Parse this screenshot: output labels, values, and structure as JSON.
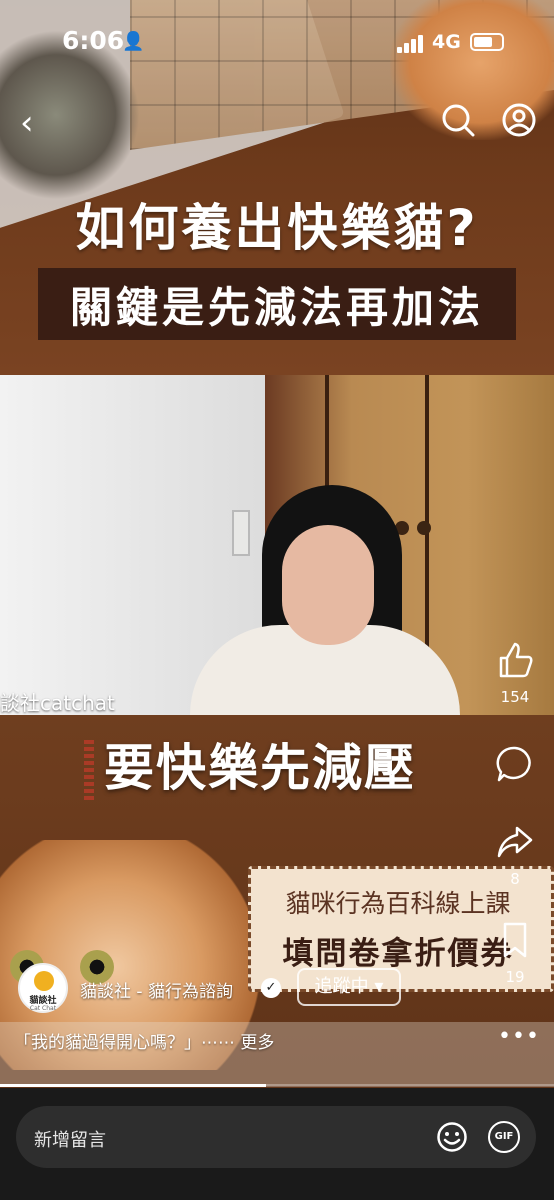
{
  "status_bar": {
    "time": "6:06",
    "network": "4G",
    "person_glyph": "👤"
  },
  "nav": {
    "back_glyph": "‹"
  },
  "video": {
    "title_line1": "如何養出快樂貓?",
    "title_line2": "關鍵是先減法再加法",
    "subtitle": "要快樂先減壓",
    "watermark": "談社catchat",
    "promo_line1": "貓咪行為百科線上課",
    "promo_line2": "填問卷拿折價券"
  },
  "actions": {
    "like_count": "154",
    "share_count": "8",
    "save_count": "19"
  },
  "account": {
    "avatar_text": "貓談社",
    "avatar_subtext": "Cat Chat",
    "name": "貓談社 - 貓行為諮詢",
    "verified_glyph": "✓",
    "follow_label": "追蹤中 ▾"
  },
  "caption": {
    "text": "「我的貓過得開心嗎？」⋯⋯ 更多",
    "more_glyph": "•••"
  },
  "playback": {
    "progress": 0.48
  },
  "composer": {
    "placeholder": "新增留言",
    "gif_label": "GIF"
  }
}
